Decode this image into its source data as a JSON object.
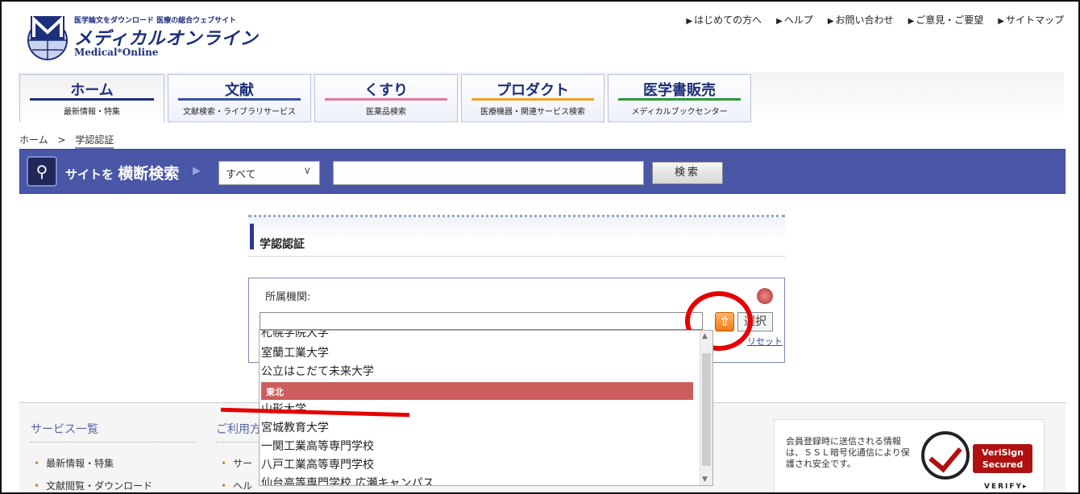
{
  "header": {
    "tagline": "医学論文をダウンロード 医療の総合ウェブサイト",
    "logo_jp": "メディカルオンライン",
    "logo_en": "Medical*Online",
    "links": [
      "はじめての方へ",
      "ヘルプ",
      "お問い合わせ",
      "ご意見・ご要望",
      "サイトマップ"
    ]
  },
  "tabs": [
    {
      "title": "ホーム",
      "sub": "最新情報・特集",
      "color": "#1d2f7a"
    },
    {
      "title": "文献",
      "sub": "文献検索・ライブラリサービス",
      "color": "#3a4fa8"
    },
    {
      "title": "くすり",
      "sub": "医薬品検索",
      "color": "#e07aa0"
    },
    {
      "title": "プロダクト",
      "sub": "医療機器・関連サービス検索",
      "color": "#f0a020"
    },
    {
      "title": "医学書販売",
      "sub": "メディカルブックセンター",
      "color": "#2a9a3a"
    }
  ],
  "breadcrumb": {
    "home": "ホーム",
    "sep": ">",
    "current": "学認認証"
  },
  "search": {
    "label_prefix": "サイトを",
    "label_main": "横断検索",
    "scope": "すべて",
    "button": "検索"
  },
  "auth": {
    "title": "学認認証",
    "field_label": "所属機関:",
    "select_button": "選択",
    "reset_link": "リセット"
  },
  "dropdown": {
    "items_before": [
      "札幌学院大学",
      "室蘭工業大学",
      "公立はこだて未来大学"
    ],
    "group": "東北",
    "items_after": [
      "山形大学",
      "宮城教育大学",
      "一関工業高等専門学校",
      "八戸工業高等専門学校",
      "仙台高等専門学校 広瀬キャンパス"
    ]
  },
  "footer": {
    "col1_title": "サービス一覧",
    "col1_items": [
      "最新情報・特集",
      "文献閲覧・ダウンロード"
    ],
    "col2_title": "ご利用方",
    "col2_items": [
      "サー",
      "ヘル"
    ],
    "ssl_text": "会員登録時に送信される情報は、ＳＳＬ暗号化通信により保護され安全です。",
    "verisign_badge": "VeriSign Secured",
    "verisign_verify": "VERIFY▸"
  },
  "colors": {
    "brand": "#1d2f7a",
    "search_bar": "#4a56a6",
    "group_header": "#cd5c5c",
    "annotation": "#e60000"
  }
}
